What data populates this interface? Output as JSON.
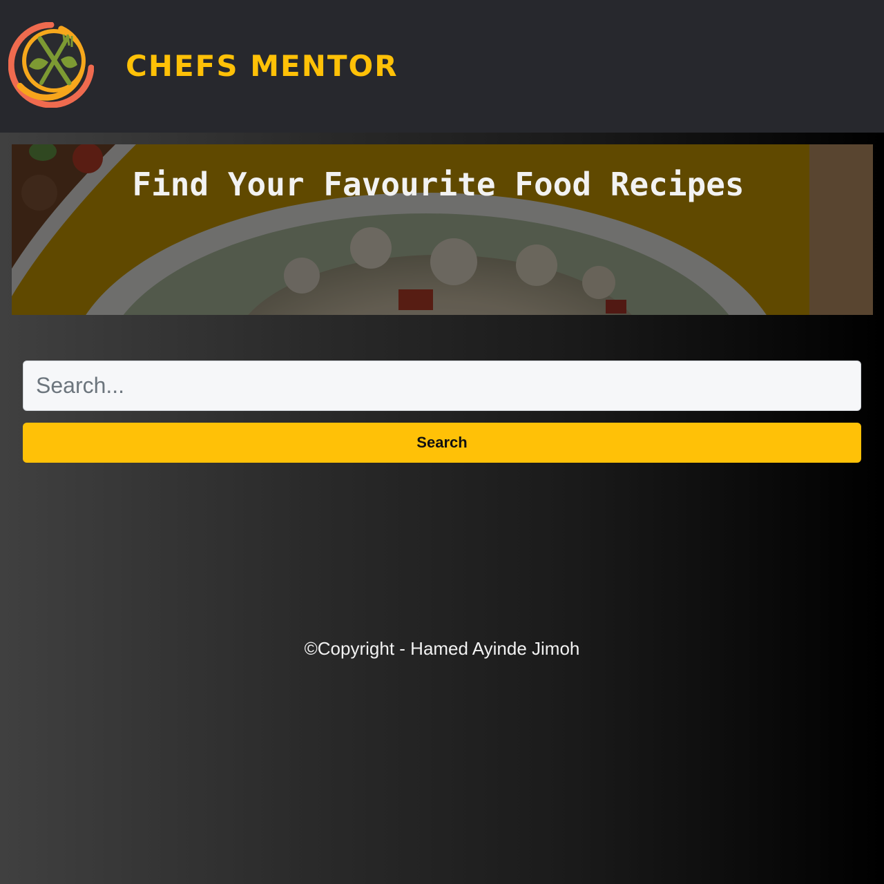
{
  "header": {
    "logo_icon": "chef-fork-leaf-logo-icon",
    "brand_name": "CHEFS MENTOR"
  },
  "hero": {
    "title": "Find Your Favourite Food Recipes",
    "image": "rice-bowl-food-photo"
  },
  "search": {
    "placeholder": "Search...",
    "value": "",
    "button_label": "Search"
  },
  "footer": {
    "copyright": "©Copyright - Hamed Ayinde Jimoh"
  },
  "colors": {
    "accent": "#ffc107",
    "header_bg": "#27282d",
    "input_bg": "#f6f7f9"
  }
}
